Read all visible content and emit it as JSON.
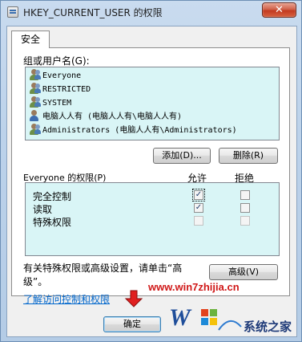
{
  "window": {
    "title": "HKEY_CURRENT_USER 的权限",
    "close_label": "✕"
  },
  "tabs": [
    {
      "label": "安全"
    }
  ],
  "users": {
    "label": "组或用户名(G):",
    "items": [
      {
        "icon": "group-users-icon",
        "name": "Everyone"
      },
      {
        "icon": "group-users-icon",
        "name": "RESTRICTED"
      },
      {
        "icon": "group-users-icon",
        "name": "SYSTEM"
      },
      {
        "icon": "user-icon",
        "name": "电脑人人有 (电脑人人有\\电脑人人有)"
      },
      {
        "icon": "group-users-icon",
        "name": "Administrators (电脑人人有\\Administrators)"
      }
    ],
    "add_label": "添加(D)...",
    "remove_label": "删除(R)"
  },
  "permissions": {
    "label": "Everyone 的权限(P)",
    "allow_header": "允许",
    "deny_header": "拒绝",
    "rows": [
      {
        "name": "完全控制",
        "allow": true,
        "deny": false
      },
      {
        "name": "读取",
        "allow": true,
        "deny": false
      },
      {
        "name": "特殊权限",
        "allow": false,
        "deny": false
      }
    ]
  },
  "advanced": {
    "text": "有关特殊权限或高级设置，请单击“高级”。",
    "button_label": "高级(V)"
  },
  "learn_link": "了解访问控制和权限",
  "footer": {
    "ok_label": "确定"
  },
  "watermark": {
    "url": "www.win7zhijia.cn",
    "site": "系统之家"
  },
  "colors": {
    "list_bg": "#d9f5f6",
    "link": "#0066cc",
    "close": "#c23a20"
  }
}
